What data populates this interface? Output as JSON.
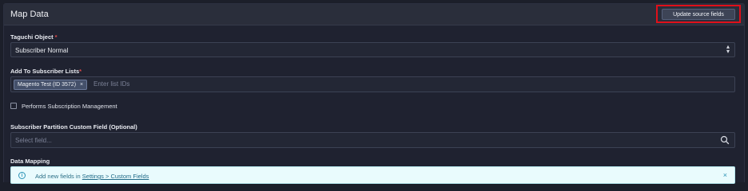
{
  "header": {
    "title": "Map Data",
    "update_button": "Update source fields"
  },
  "taguchi_object": {
    "label": "Taguchi Object",
    "required_mark": "*",
    "value": "Subscriber Normal"
  },
  "subscriber_lists": {
    "label": "Add To Subscriber Lists",
    "required_mark": "*",
    "tags": [
      "Magento Test (ID 3572)"
    ],
    "tag_remove": "×",
    "placeholder": "Enter list IDs"
  },
  "subscription_management": {
    "label": "Performs Subscription Management",
    "checked": false
  },
  "partition_field": {
    "label": "Subscriber Partition Custom Field (Optional)",
    "placeholder": "Select field..."
  },
  "data_mapping": {
    "label": "Data Mapping",
    "alert_prefix": "Add new fields in",
    "alert_link": "Settings > Custom Fields",
    "alert_close": "×"
  },
  "colors": {
    "background": "#1c1f2a",
    "highlight": "#e0101a",
    "alert_bg": "#e9fbfd",
    "required": "#e04a4a"
  },
  "icons": [
    "up-down-icon",
    "close-icon",
    "search-icon",
    "info-icon"
  ]
}
